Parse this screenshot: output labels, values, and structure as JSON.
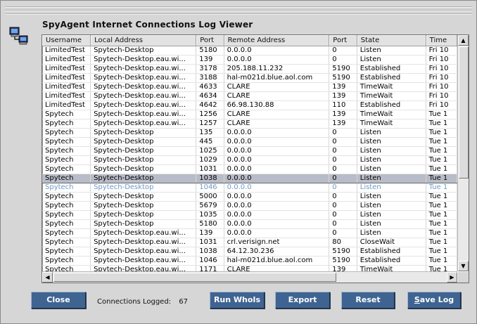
{
  "window": {
    "title": "SpyAgent Internet Connections Log Viewer"
  },
  "colors": {
    "button": "#3f6491",
    "selection": "#b8bcc8",
    "faded_text": "#6f98c8"
  },
  "icons": {
    "app": "computer-network-icon"
  },
  "table": {
    "columns": [
      "Username",
      "Local Address",
      "Port",
      "Remote Address",
      "Port",
      "State",
      "Time"
    ],
    "rows": [
      [
        "LimitedTest",
        "Spytech-Desktop",
        "5180",
        "0.0.0.0",
        "0",
        "Listen",
        "Fri 10"
      ],
      [
        "LimitedTest",
        "Spytech-Desktop.eau.wi...",
        "139",
        "0.0.0.0",
        "0",
        "Listen",
        "Fri 10"
      ],
      [
        "LimitedTest",
        "Spytech-Desktop.eau.wi...",
        "3178",
        "205.188.11.232",
        "5190",
        "Established",
        "Fri 10"
      ],
      [
        "LimitedTest",
        "Spytech-Desktop.eau.wi...",
        "3188",
        "hal-m021d.blue.aol.com",
        "5190",
        "Established",
        "Fri 10"
      ],
      [
        "LimitedTest",
        "Spytech-Desktop.eau.wi...",
        "4633",
        "CLARE",
        "139",
        "TimeWait",
        "Fri 10"
      ],
      [
        "LimitedTest",
        "Spytech-Desktop.eau.wi...",
        "4634",
        "CLARE",
        "139",
        "TimeWait",
        "Fri 10"
      ],
      [
        "LimitedTest",
        "Spytech-Desktop.eau.wi...",
        "4642",
        "66.98.130.88",
        "110",
        "Established",
        "Fri 10"
      ],
      [
        "Spytech",
        "Spytech-Desktop.eau.wi...",
        "1256",
        "CLARE",
        "139",
        "TimeWait",
        "Tue 1"
      ],
      [
        "Spytech",
        "Spytech-Desktop.eau.wi...",
        "1257",
        "CLARE",
        "139",
        "TimeWait",
        "Tue 1"
      ],
      [
        "Spytech",
        "Spytech-Desktop",
        "135",
        "0.0.0.0",
        "0",
        "Listen",
        "Tue 1"
      ],
      [
        "Spytech",
        "Spytech-Desktop",
        "445",
        "0.0.0.0",
        "0",
        "Listen",
        "Tue 1"
      ],
      [
        "Spytech",
        "Spytech-Desktop",
        "1025",
        "0.0.0.0",
        "0",
        "Listen",
        "Tue 1"
      ],
      [
        "Spytech",
        "Spytech-Desktop",
        "1029",
        "0.0.0.0",
        "0",
        "Listen",
        "Tue 1"
      ],
      [
        "Spytech",
        "Spytech-Desktop",
        "1031",
        "0.0.0.0",
        "0",
        "Listen",
        "Tue 1"
      ],
      [
        "Spytech",
        "Spytech-Desktop",
        "1038",
        "0.0.0.0",
        "0",
        "Listen",
        "Tue 1"
      ],
      [
        "Spytech",
        "Spytech-Desktop",
        "1046",
        "0.0.0.0",
        "0",
        "Listen",
        "Tue 1"
      ],
      [
        "Spytech",
        "Spytech-Desktop",
        "5000",
        "0.0.0.0",
        "0",
        "Listen",
        "Tue 1"
      ],
      [
        "Spytech",
        "Spytech-Desktop",
        "5679",
        "0.0.0.0",
        "0",
        "Listen",
        "Tue 1"
      ],
      [
        "Spytech",
        "Spytech-Desktop",
        "1035",
        "0.0.0.0",
        "0",
        "Listen",
        "Tue 1"
      ],
      [
        "Spytech",
        "Spytech-Desktop",
        "5180",
        "0.0.0.0",
        "0",
        "Listen",
        "Tue 1"
      ],
      [
        "Spytech",
        "Spytech-Desktop.eau.wi...",
        "139",
        "0.0.0.0",
        "0",
        "Listen",
        "Tue 1"
      ],
      [
        "Spytech",
        "Spytech-Desktop.eau.wi...",
        "1031",
        "crl.verisign.net",
        "80",
        "CloseWait",
        "Tue 1"
      ],
      [
        "Spytech",
        "Spytech-Desktop.eau.wi...",
        "1038",
        "64.12.30.236",
        "5190",
        "Established",
        "Tue 1"
      ],
      [
        "Spytech",
        "Spytech-Desktop.eau.wi...",
        "1046",
        "hal-m021d.blue.aol.com",
        "5190",
        "Established",
        "Tue 1"
      ],
      [
        "Spytech",
        "Spytech-Desktop.eau.wi...",
        "1171",
        "CLARE",
        "139",
        "TimeWait",
        "Tue 1"
      ]
    ],
    "selected_row": 14,
    "faded_row": 15
  },
  "status": {
    "label": "Connections Logged:",
    "count": "67"
  },
  "buttons": {
    "close": "Close",
    "run_whois": "Run WhoIs",
    "export": "Export",
    "reset": "Reset",
    "save_log": "Save Log"
  }
}
